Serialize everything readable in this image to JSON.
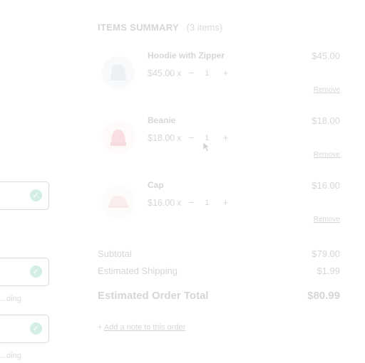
{
  "summary": {
    "title": "ITEMS SUMMARY",
    "count": "(3 items)",
    "items": [
      {
        "name": "Hoodie with Zipper",
        "unit_price": "$45.00",
        "x": "x",
        "qty": "1",
        "total": "$45.00",
        "remove": "Remove",
        "thumb_color": "#9fb4c7"
      },
      {
        "name": "Beanie",
        "unit_price": "$18.00",
        "x": "x",
        "qty": "1",
        "total": "$18.00",
        "remove": "Remove",
        "thumb_color": "#e0566f"
      },
      {
        "name": "Cap",
        "unit_price": "$16.00",
        "x": "x",
        "qty": "1",
        "total": "$16.00",
        "remove": "Remove",
        "thumb_color": "#e7a29a"
      }
    ],
    "subtotal_label": "Subtotal",
    "subtotal_value": "$79.00",
    "shipping_label": "Estimated Shipping",
    "shipping_value": "$1.99",
    "order_total_label": "Estimated Order Total",
    "order_total_value": "$80.99",
    "add_note_prefix": "+",
    "add_note_link": "Add a note to this order"
  },
  "qty_controls": {
    "minus": "−",
    "plus": "+"
  },
  "left_panel": {
    "check": "✓",
    "notes": [
      "...ding",
      "...ding"
    ]
  },
  "colors": {
    "accent": "#1aa37a",
    "text": "#1b1b1b"
  }
}
